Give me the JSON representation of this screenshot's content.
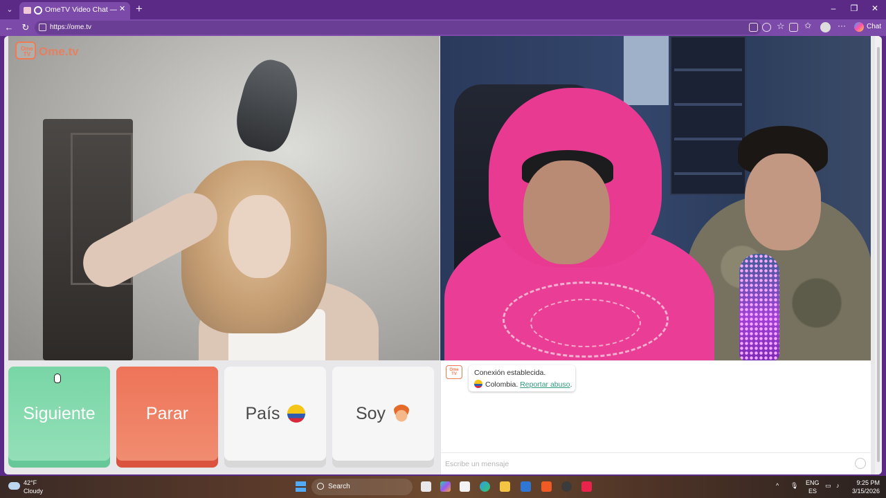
{
  "browser": {
    "tab_title": "OmeTV Video Chat — Omegl",
    "new_tab": "+",
    "url": "https://ome.tv",
    "chat_label": "Chat",
    "tab_list_icon": "chevron-down-icon",
    "window_controls": [
      "minimize-icon",
      "restore-icon",
      "close-icon"
    ]
  },
  "site": {
    "logo_badge": "Ome TV",
    "logo_word": "Ome.tv"
  },
  "controls": {
    "next_label": "Siguiente",
    "stop_label": "Parar",
    "country_label": "País",
    "gender_label": "Soy",
    "next_color": "#79d6a6",
    "stop_color": "#ee7458"
  },
  "chat": {
    "logo_badge": "Ome TV",
    "status": "Conexión establecida.",
    "country": "Colombia.",
    "report_link": "Reportar abuso",
    "report_suffix": ".",
    "input_placeholder": "Escribe un mensaje"
  },
  "taskbar": {
    "weather_temp": "42°F",
    "weather_desc": "Cloudy",
    "search_label": "Search",
    "lang_line1": "ENG",
    "lang_line2": "ES",
    "time": "9:25 PM",
    "date": "3/15/2026"
  }
}
